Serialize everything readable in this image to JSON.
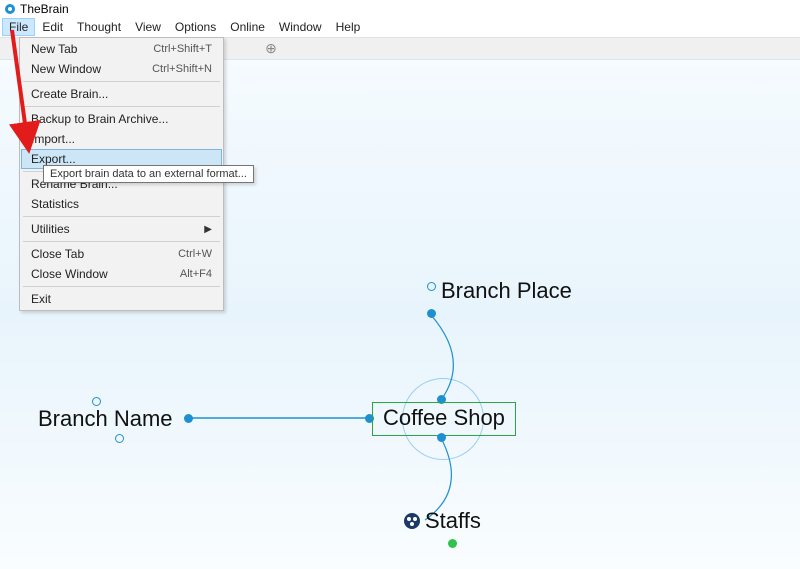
{
  "title": "TheBrain",
  "menubar": [
    "File",
    "Edit",
    "Thought",
    "View",
    "Options",
    "Online",
    "Window",
    "Help"
  ],
  "menubar_open_index": 0,
  "file_menu": {
    "items": [
      {
        "label": "New Tab",
        "shortcut": "Ctrl+Shift+T"
      },
      {
        "label": "New Window",
        "shortcut": "Ctrl+Shift+N"
      },
      {
        "sep": true
      },
      {
        "label": "Create Brain...",
        "shortcut": ""
      },
      {
        "sep": true
      },
      {
        "label": "Backup to Brain Archive...",
        "shortcut": ""
      },
      {
        "label": "Import...",
        "shortcut": ""
      },
      {
        "label": "Export...",
        "shortcut": "",
        "highlight": true
      },
      {
        "sep": true
      },
      {
        "label": "Rename Brain...",
        "shortcut": ""
      },
      {
        "label": "Statistics",
        "shortcut": ""
      },
      {
        "sep": true
      },
      {
        "label": "Utilities",
        "shortcut": "",
        "submenu": true
      },
      {
        "sep": true
      },
      {
        "label": "Close Tab",
        "shortcut": "Ctrl+W"
      },
      {
        "label": "Close Window",
        "shortcut": "Alt+F4"
      },
      {
        "sep": true
      },
      {
        "label": "Exit",
        "shortcut": ""
      }
    ],
    "tooltip": "Export brain data to an external format..."
  },
  "nodes": {
    "center": "Coffee Shop",
    "top": "Branch Place",
    "left": "Branch Name",
    "bottom": "Staffs"
  }
}
